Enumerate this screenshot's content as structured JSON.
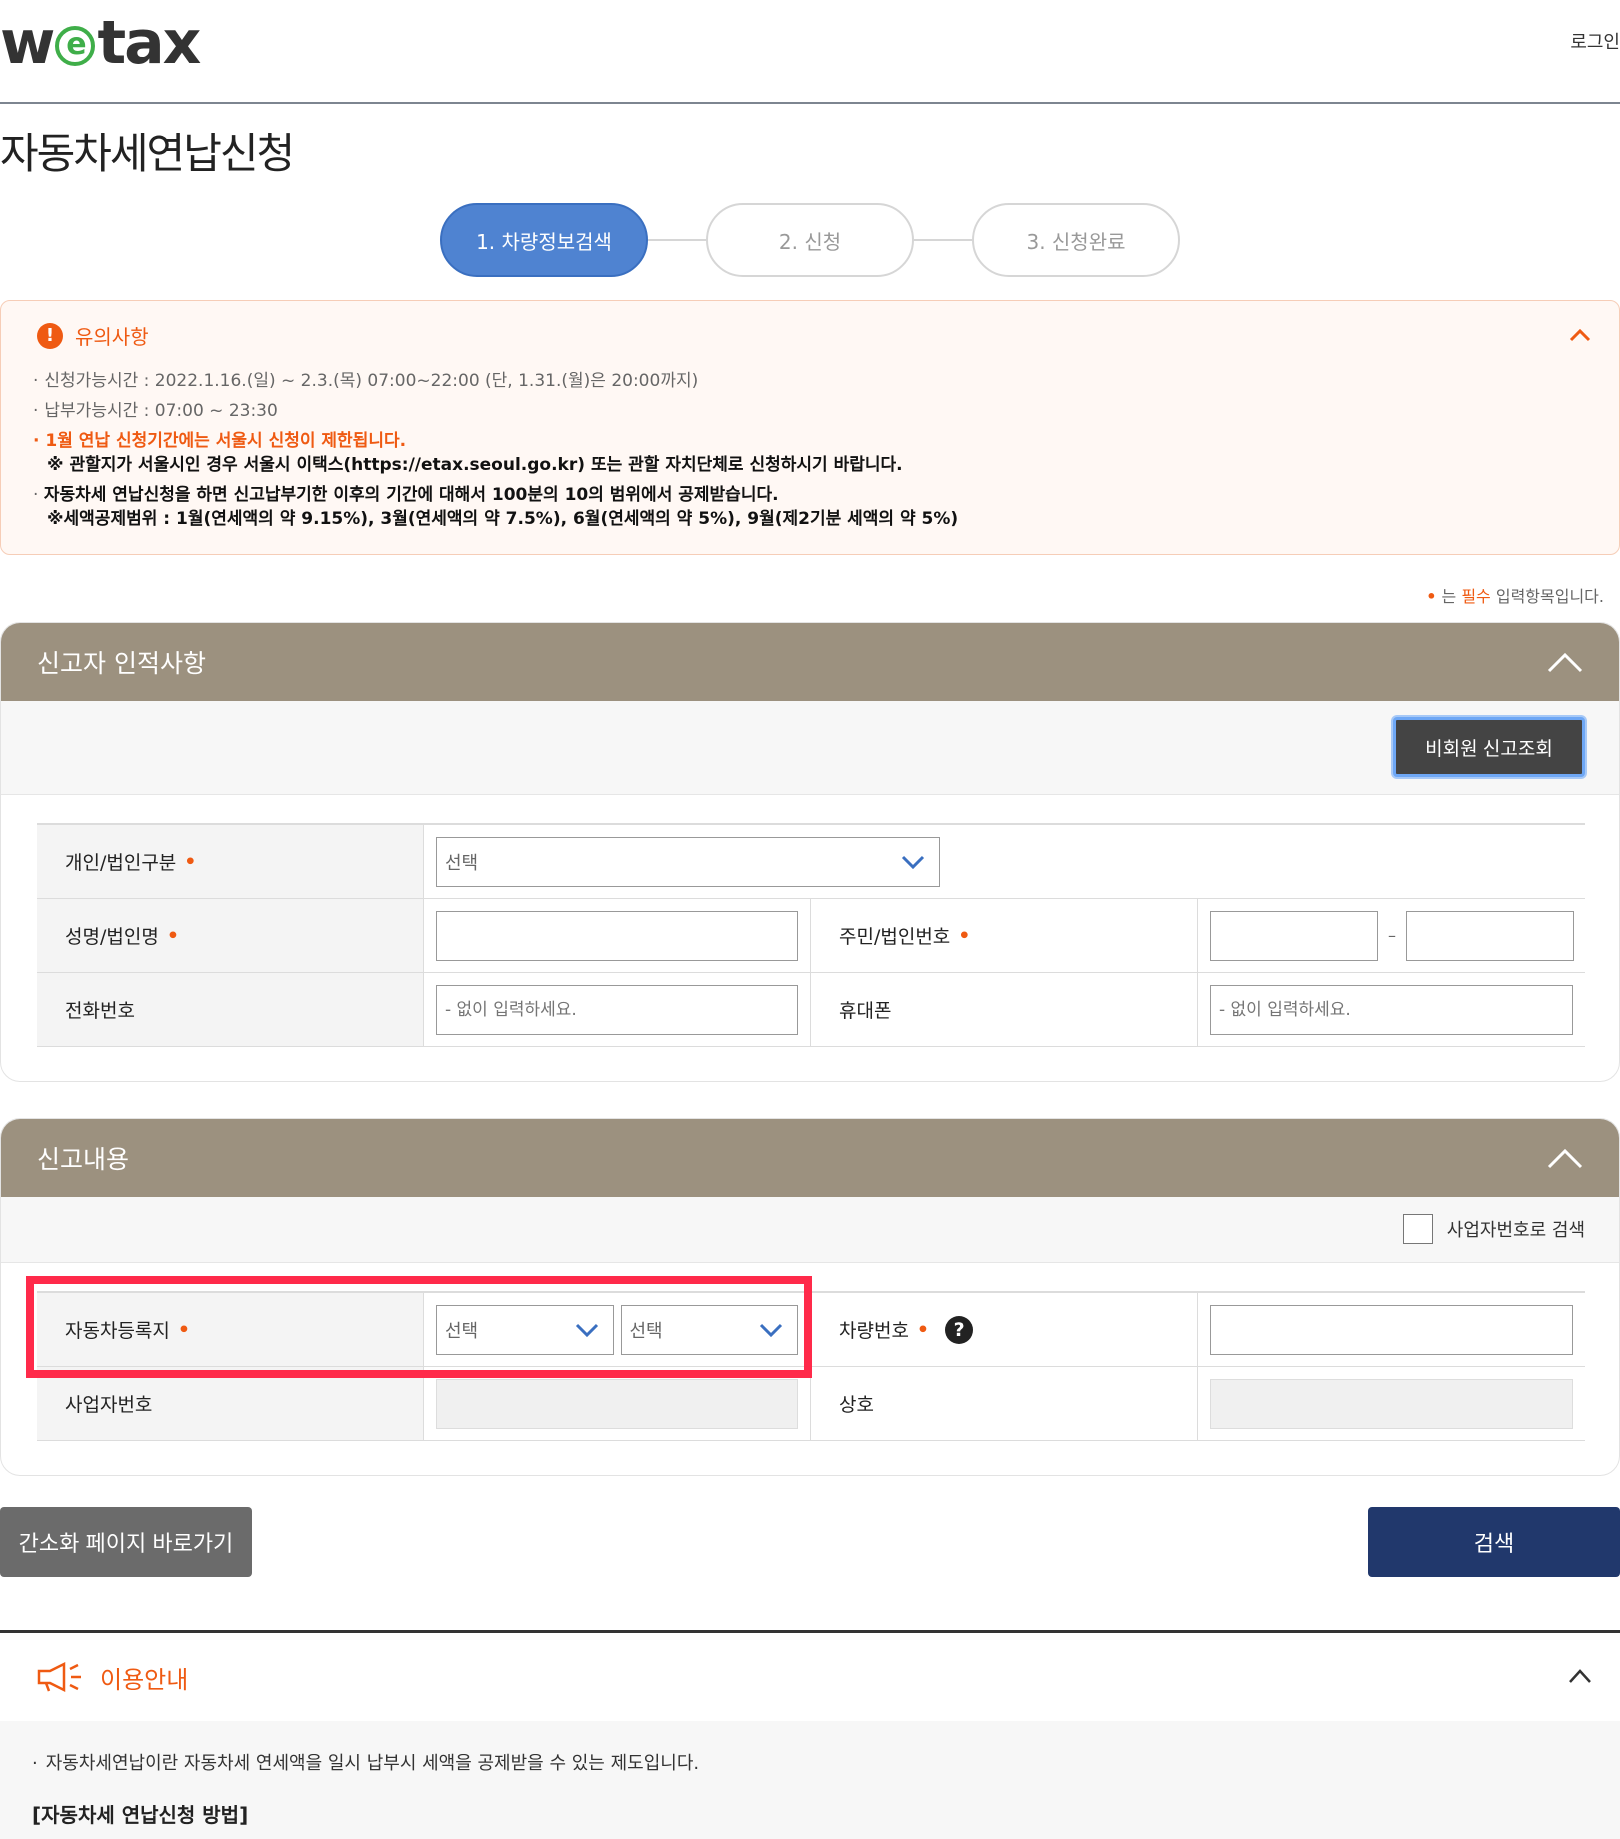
{
  "header": {
    "logo": "wetax",
    "login": "로그인"
  },
  "page_title": "자동차세연납신청",
  "steps": [
    {
      "label": "1. 차량정보검색",
      "active": true
    },
    {
      "label": "2. 신청",
      "active": false
    },
    {
      "label": "3. 신청완료",
      "active": false
    }
  ],
  "notice": {
    "title": "유의사항",
    "lines": [
      "신청가능시간 : 2022.1.16.(일) ~ 2.3.(목) 07:00~22:00 (단, 1.31.(월)은 20:00까지)",
      "납부가능시간 : 07:00 ~ 23:30"
    ],
    "warn1": "1월 연납 신청기간에는 서울시 신청이 제한됩니다.",
    "warn1_sub": "※ 관할지가 서울시인 경우 서울시 이택스(https://etax.seoul.go.kr) 또는 관할 자치단체로 신청하시기 바랍니다.",
    "warn2": "자동차세 연납신청을 하면 신고납부기한 이후의 기간에 대해서 100분의 10의 범위에서 공제받습니다.",
    "warn2_sub": "※세액공제범위 : 1월(연세액의 약 9.15%), 3월(연세액의 약 7.5%), 6월(연세액의 약 5%), 9월(제2기분 세액의 약 5%)"
  },
  "required_note": {
    "prefix": "는 ",
    "must": "필수",
    "suffix": " 입력항목입니다."
  },
  "section1": {
    "title": "신고자 인적사항",
    "nonmember_btn": "비회원 신고조회",
    "fields": {
      "type_label": "개인/법인구분",
      "type_value": "선택",
      "name_label": "성명/법인명",
      "id_label": "주민/법인번호",
      "phone_label": "전화번호",
      "phone_placeholder": "- 없이 입력하세요.",
      "mobile_label": "휴대폰",
      "mobile_placeholder": "- 없이 입력하세요."
    }
  },
  "section2": {
    "title": "신고내용",
    "biz_search_label": "사업자번호로 검색",
    "fields": {
      "region_label": "자동차등록지",
      "region_sel1": "선택",
      "region_sel2": "선택",
      "car_no_label": "차량번호",
      "help": "?",
      "biz_no_label": "사업자번호",
      "company_label": "상호"
    }
  },
  "buttons": {
    "simple": "간소화 페이지 바로가기",
    "search": "검색"
  },
  "guide": {
    "title": "이용안내",
    "line1": "자동차세연납이란 자동차세 연세액을 일시 납부시 세액을 공제받을 수 있는 제도입니다.",
    "heading": "[자동차세 연납신청 방법]"
  },
  "colors": {
    "accent_orange": "#ef5a12",
    "panel_head": "#9c917f",
    "step_active": "#4f83d1",
    "search_btn": "#21386c",
    "highlight": "#ff2a4a"
  }
}
